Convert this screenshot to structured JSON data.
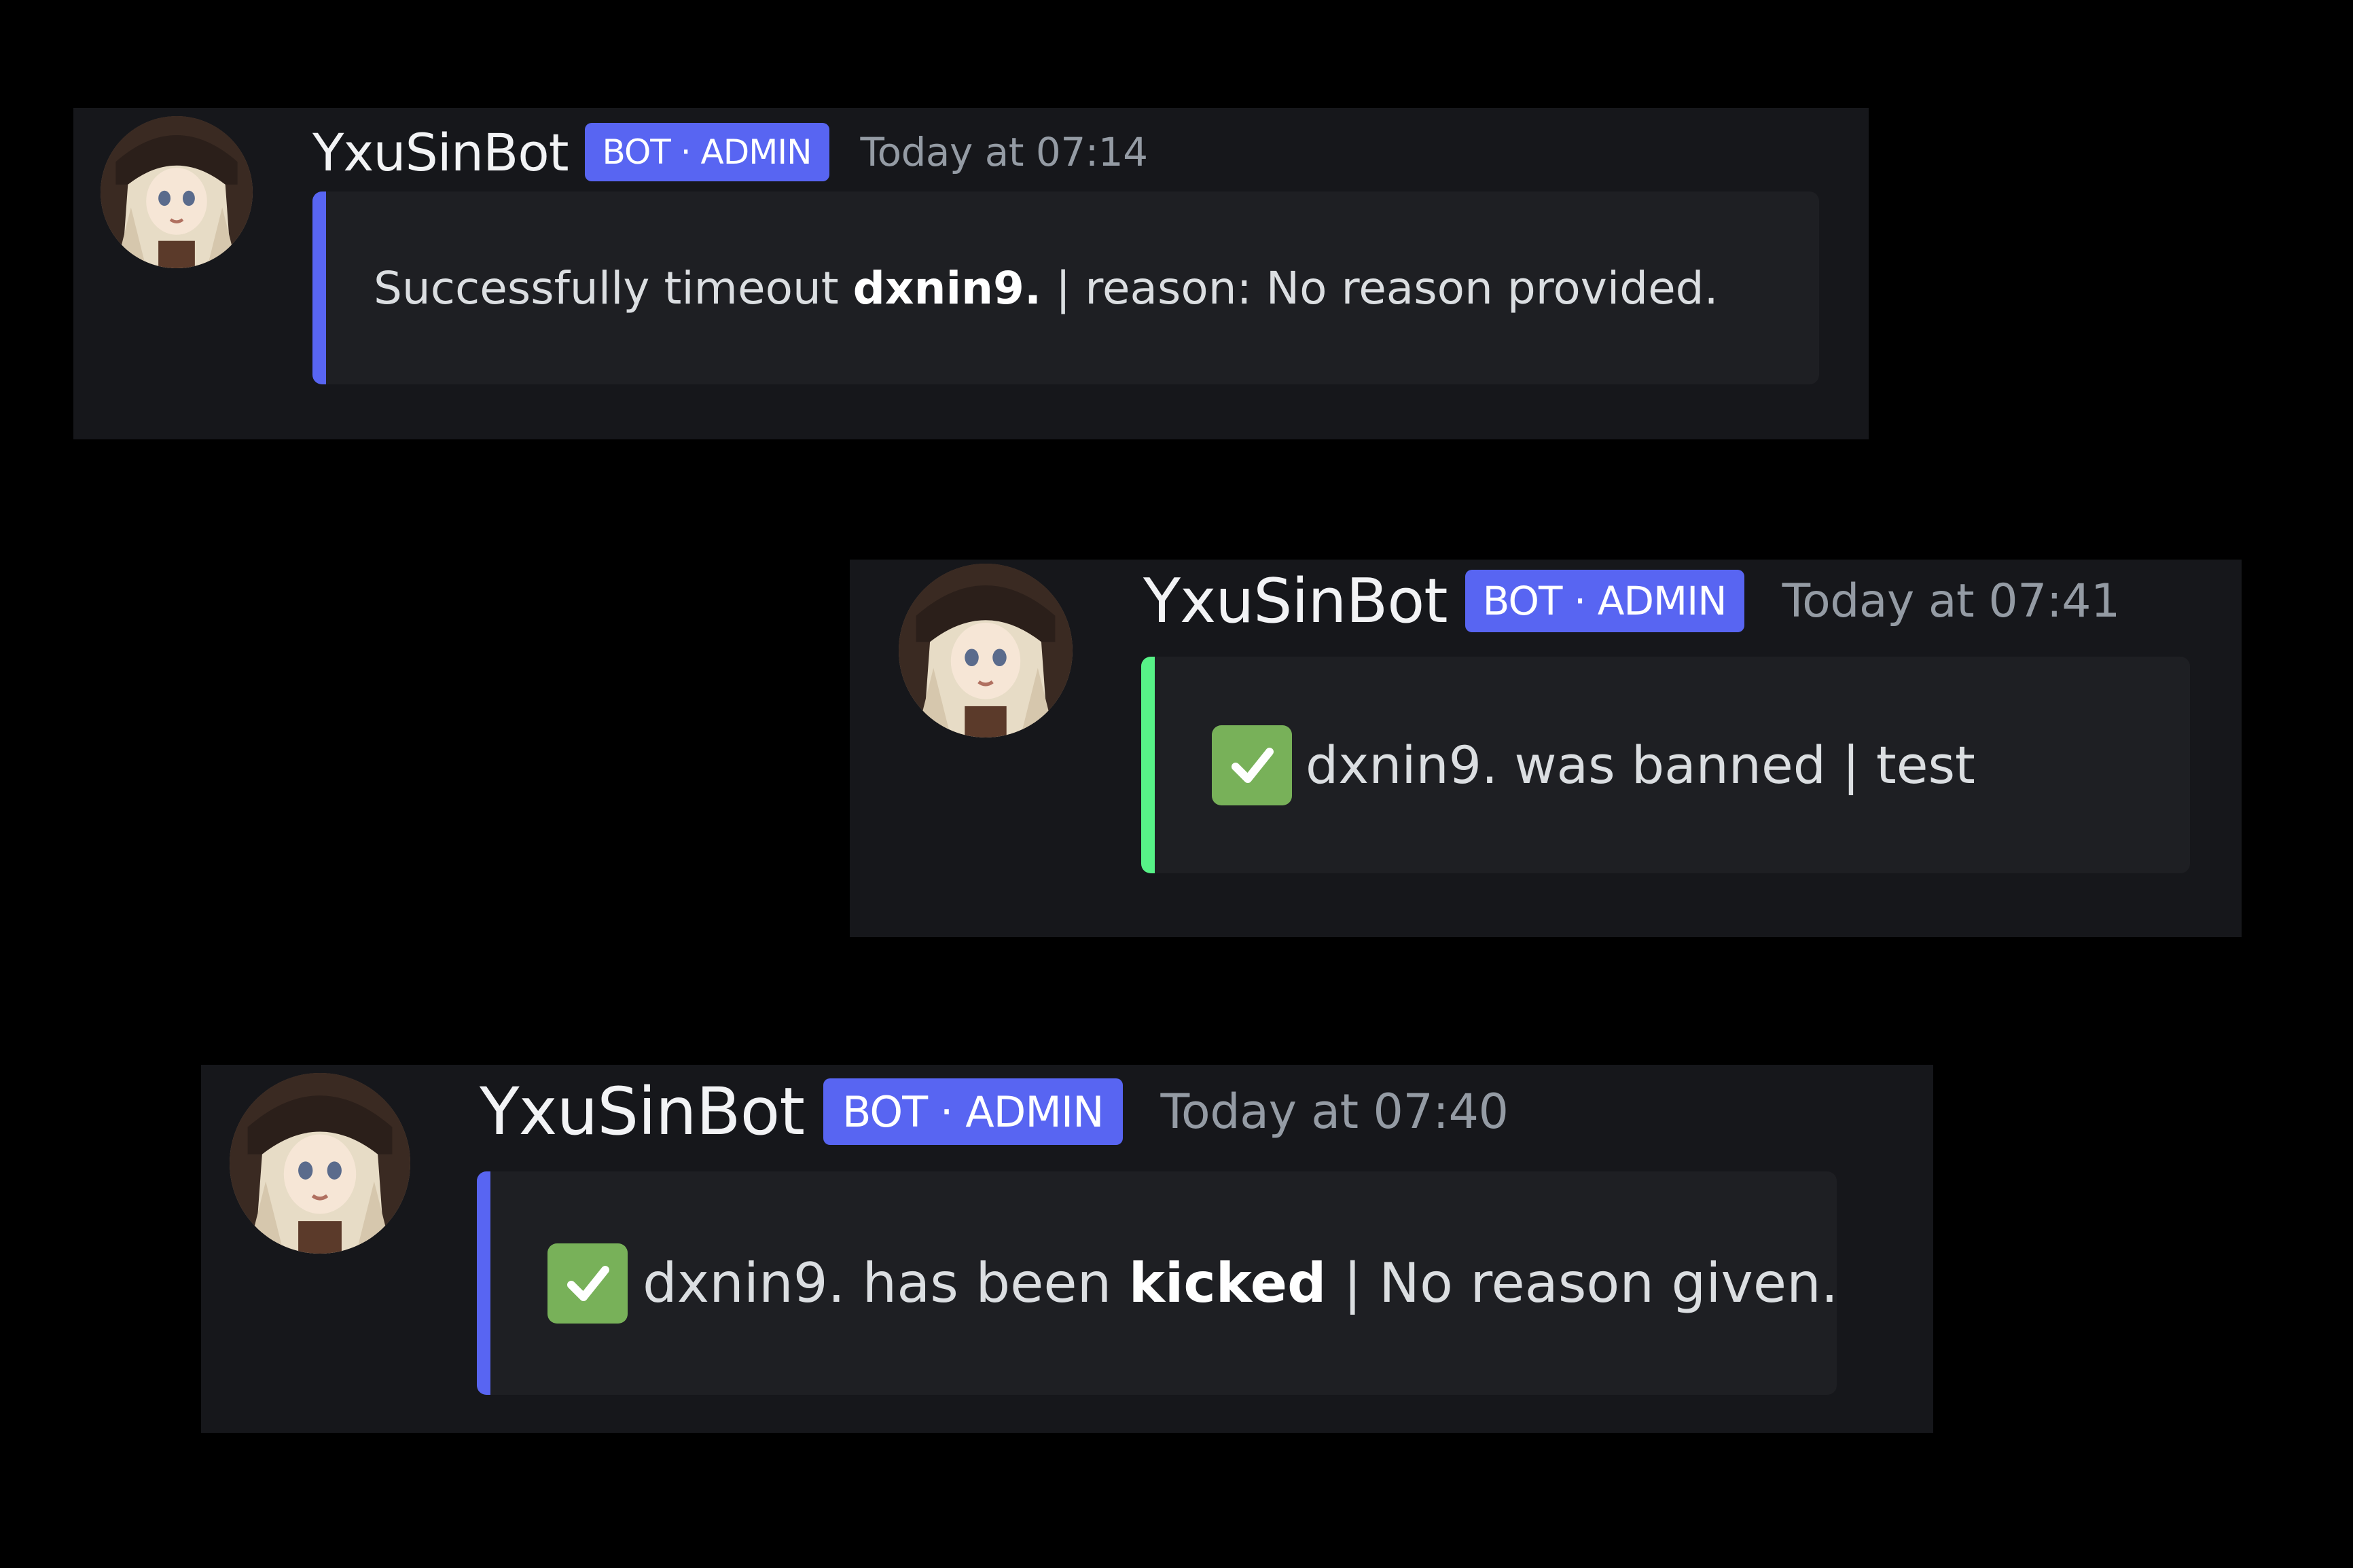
{
  "messages": [
    {
      "id": "m1",
      "author": "YxuSinBot",
      "badge": "BOT · ADMIN",
      "timestamp": "Today at 07:14",
      "embed_color": "#5865f2",
      "embed_icon": "",
      "text_before": "Successfully timeout ",
      "text_bold": "dxnin9.",
      "text_after": " | reason: No reason provided."
    },
    {
      "id": "m2",
      "author": "YxuSinBot",
      "badge": "BOT · ADMIN",
      "timestamp": "Today at 07:41",
      "embed_color": "#57f287",
      "embed_icon": "white-check-mark-icon",
      "text_before": "dxnin9. was banned | test",
      "text_bold": "",
      "text_after": ""
    },
    {
      "id": "m3",
      "author": "YxuSinBot",
      "badge": "BOT · ADMIN",
      "timestamp": "Today at 07:40",
      "embed_color": "#5865f2",
      "embed_icon": "white-check-mark-icon",
      "text_before": "dxnin9. has been ",
      "text_bold": "kicked",
      "text_after": " | No reason given."
    }
  ]
}
